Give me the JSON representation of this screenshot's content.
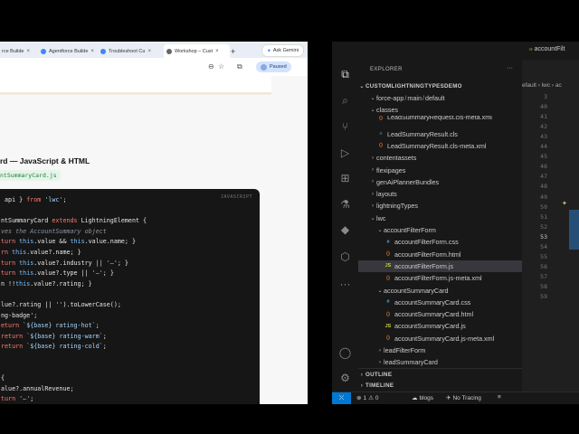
{
  "browser": {
    "tabs": [
      {
        "label": "rce Builde"
      },
      {
        "label": "Agentforce Builde"
      },
      {
        "label": "Troubleshoot Cu"
      },
      {
        "label": "Workshop – Cust",
        "active": true
      }
    ],
    "new_tab_label": "+",
    "ask_gemini": "Ask Gemini",
    "paused_label": "Paused",
    "content": {
      "section_title": "rd — JavaScript & HTML",
      "file_chip": "ntSummaryCard.js",
      "code_lang": "JAVASCRIPT",
      "code_lines": [
        " api } from 'lwc';",
        "",
        "ntSummaryCard extends LightningElement {",
        "ves the AccountSummary object",
        "turn this.value && this.value.name; }",
        "rn this.value?.name; }",
        "turn this.value?.industry || '—'; }",
        "turn this.value?.type || '—'; }",
        "n !!this.value?.rating; }",
        "",
        "lue?.rating || '').toLowerCase();",
        "ng-badge';",
        "eturn `${base} rating-hot`;",
        "return `${base} rating-warm`;",
        "return `${base} rating-cold`;",
        "",
        "",
        "{",
        "alue?.annualRevenue;",
        "turn '—';",
        "mberFormat('en-US', {",
        "cy', currency: 'USD', maximumFractionDigits: 0"
      ]
    }
  },
  "vscode": {
    "explorer_title": "EXPLORER",
    "explorer_more": "···",
    "root": "CUSTOMLIGHTNINGTYPESDEMO",
    "path_segments": [
      "force-app",
      "main",
      "default"
    ],
    "tree": [
      {
        "label": "classes",
        "indent": 2,
        "type": "folder-open"
      },
      {
        "label": "LeadSummaryRequest.cls-meta.xml",
        "indent": 3,
        "type": "xml",
        "partial": true
      },
      {
        "label": "LeadSummaryResult.cls",
        "indent": 3,
        "type": "cls"
      },
      {
        "label": "LeadSummaryResult.cls-meta.xml",
        "indent": 3,
        "type": "xml"
      },
      {
        "label": "contentassets",
        "indent": 2,
        "type": "folder"
      },
      {
        "label": "flexipages",
        "indent": 2,
        "type": "folder"
      },
      {
        "label": "genAiPlannerBundles",
        "indent": 2,
        "type": "folder"
      },
      {
        "label": "layouts",
        "indent": 2,
        "type": "folder"
      },
      {
        "label": "lightningTypes",
        "indent": 2,
        "type": "folder"
      },
      {
        "label": "lwc",
        "indent": 2,
        "type": "folder-open"
      },
      {
        "label": "accountFilterForm",
        "indent": 3,
        "type": "folder-open"
      },
      {
        "label": "accountFilterForm.css",
        "indent": 4,
        "type": "css"
      },
      {
        "label": "accountFilterForm.html",
        "indent": 4,
        "type": "html"
      },
      {
        "label": "accountFilterForm.js",
        "indent": 4,
        "type": "js",
        "selected": true
      },
      {
        "label": "accountFilterForm.js-meta.xml",
        "indent": 4,
        "type": "xml"
      },
      {
        "label": "accountSummaryCard",
        "indent": 3,
        "type": "folder-open"
      },
      {
        "label": "accountSummaryCard.css",
        "indent": 4,
        "type": "css"
      },
      {
        "label": "accountSummaryCard.html",
        "indent": 4,
        "type": "html"
      },
      {
        "label": "accountSummaryCard.js",
        "indent": 4,
        "type": "js"
      },
      {
        "label": "accountSummaryCard.js-meta.xml",
        "indent": 4,
        "type": "xml"
      },
      {
        "label": "leadFilterForm",
        "indent": 3,
        "type": "folder"
      },
      {
        "label": "leadSummaryCard",
        "indent": 3,
        "type": "folder"
      }
    ],
    "outline_label": "OUTLINE",
    "timeline_label": "TIMELINE",
    "editor_tab": "accountFilt",
    "breadcrumb": "efault › lwc › ac",
    "line_numbers": [
      "3",
      "40",
      "41",
      "42",
      "43",
      "44",
      "45",
      "46",
      "47",
      "48",
      "49",
      "50",
      "51",
      "52",
      "53",
      "54",
      "55",
      "56",
      "57",
      "58",
      "59"
    ],
    "current_line": "53",
    "status": {
      "errors": "1",
      "warnings": "0",
      "branch": "blogs",
      "tracing": "No Tracing"
    }
  }
}
